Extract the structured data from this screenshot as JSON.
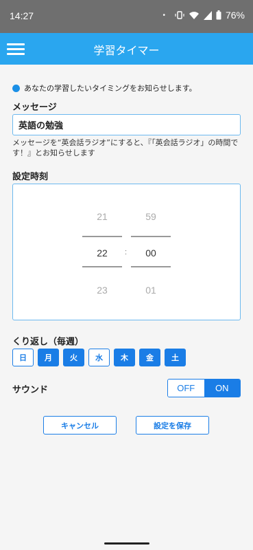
{
  "status_bar": {
    "time": "14:27",
    "dot": "•",
    "battery": "76%"
  },
  "app_bar": {
    "title": "学習タイマー",
    "menu_icon": "hamburger-menu-icon"
  },
  "info": {
    "text": "あなたの学習したいタイミングをお知らせします。",
    "accent": "#1a8fe6"
  },
  "message": {
    "label": "メッセージ",
    "value": "英語の勉強",
    "hint": "メッセージを“英会話ラジオ”にすると、『「英会話ラジオ」の時間です！』とお知らせします"
  },
  "time": {
    "label": "設定時刻",
    "hour_prev": "21",
    "hour": "22",
    "hour_next": "23",
    "separator": ":",
    "minute_prev": "59",
    "minute": "00",
    "minute_next": "01"
  },
  "repeat": {
    "label": "くり返し（毎週）",
    "days": [
      {
        "label": "日",
        "active": false
      },
      {
        "label": "月",
        "active": true
      },
      {
        "label": "火",
        "active": true
      },
      {
        "label": "水",
        "active": false
      },
      {
        "label": "木",
        "active": true
      },
      {
        "label": "金",
        "active": true
      },
      {
        "label": "土",
        "active": true
      }
    ]
  },
  "sound": {
    "label": "サウンド",
    "off_label": "OFF",
    "on_label": "ON",
    "selected": "ON"
  },
  "actions": {
    "cancel_label": "キャンセル",
    "save_label": "設定を保存"
  },
  "colors": {
    "app_bar": "#2aa6ef",
    "primary": "#1a7de6",
    "status_bar": "#6f6f6f"
  }
}
